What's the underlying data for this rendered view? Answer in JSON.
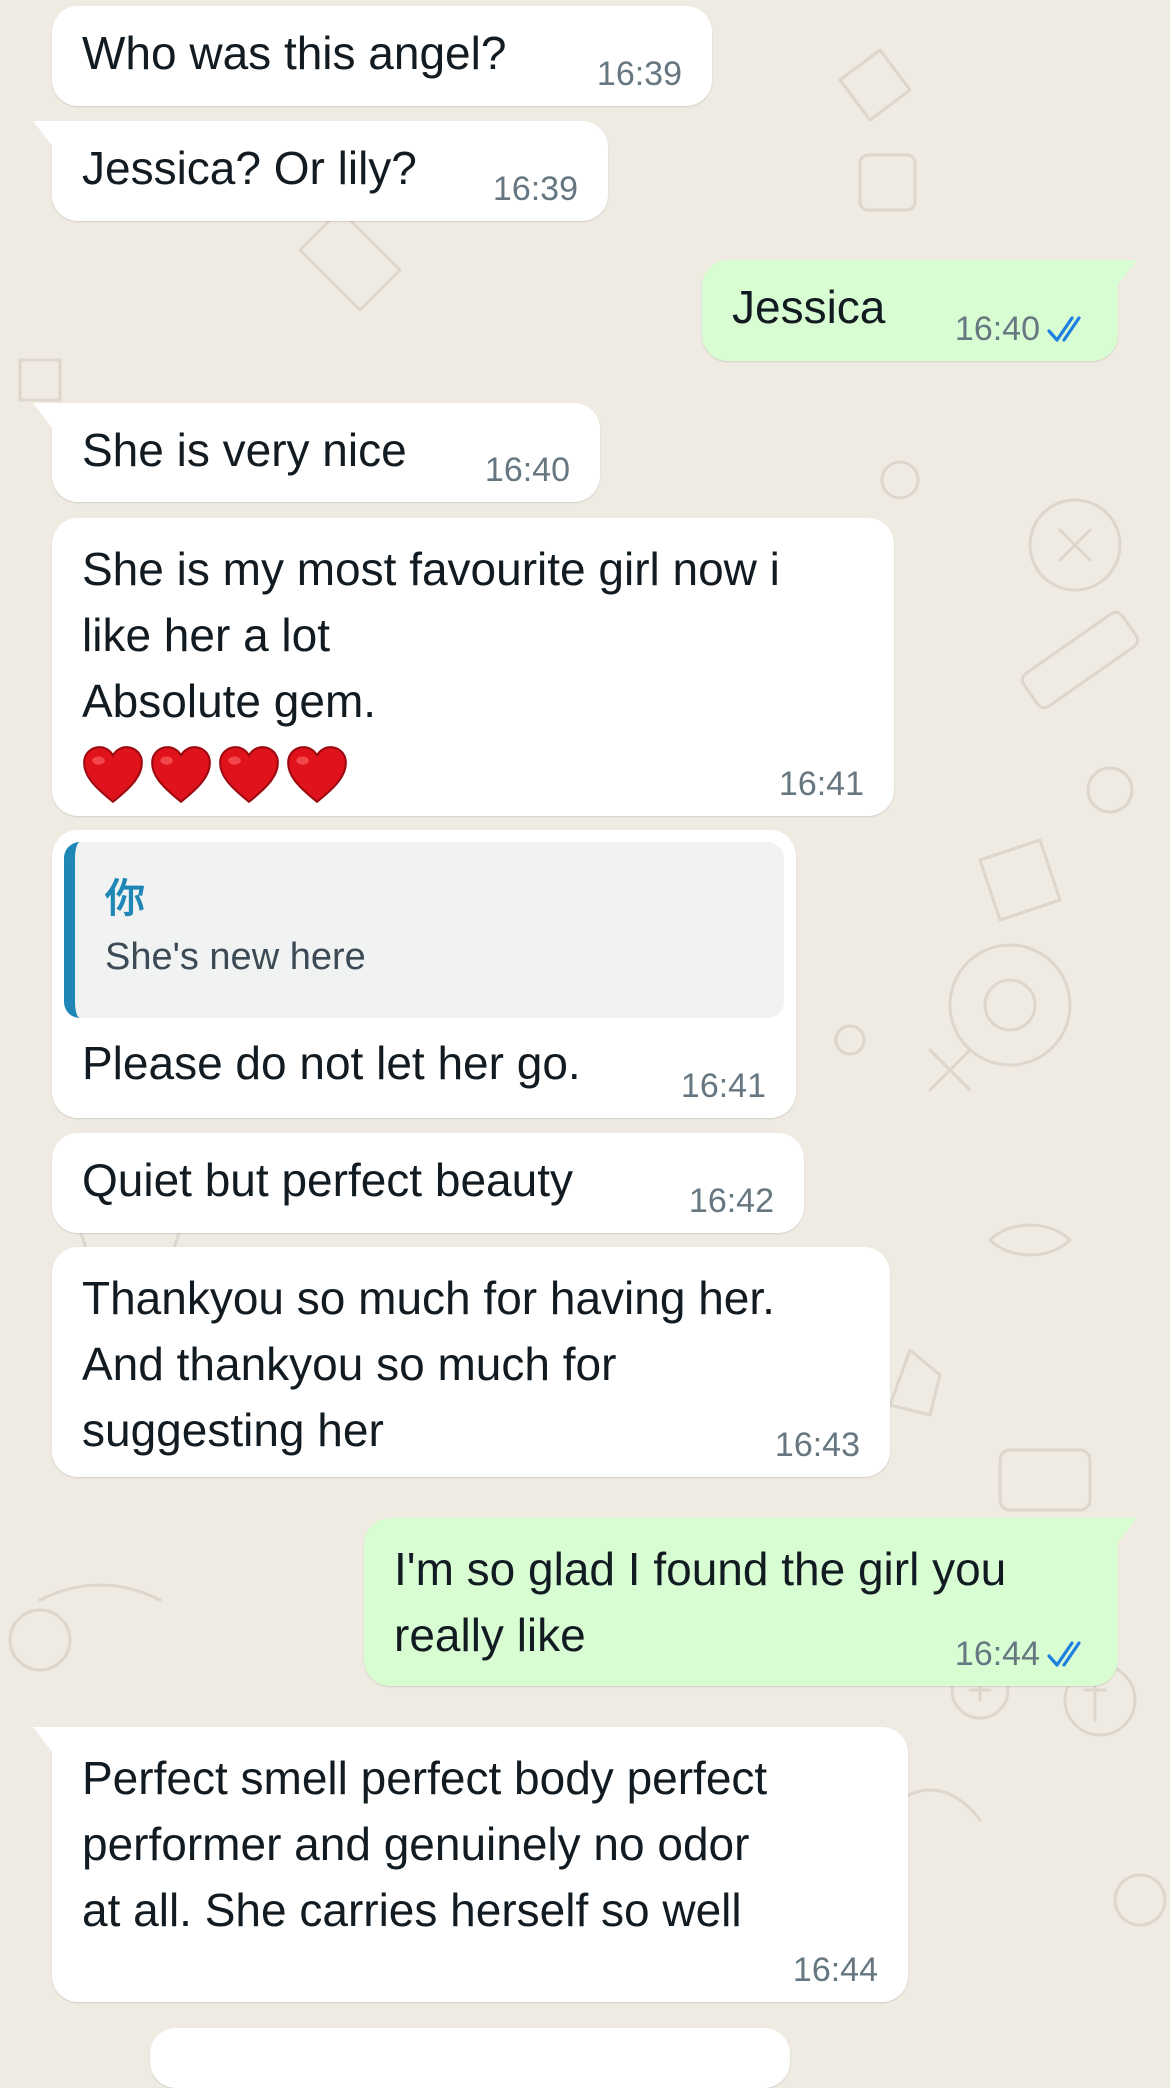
{
  "colors": {
    "chat_background": "#efeae2",
    "incoming_bubble": "#ffffff",
    "outgoing_bubble": "#d9fdd3",
    "read_receipt": "#1d7fe0",
    "quote_accent": "#1f87b5"
  },
  "messages": [
    {
      "direction": "incoming",
      "text": "Who was this angel?",
      "time": "16:39"
    },
    {
      "direction": "incoming",
      "text": "Jessica? Or lily?",
      "time": "16:39"
    },
    {
      "direction": "outgoing",
      "text": "Jessica",
      "time": "16:40",
      "status": "read",
      "status_icon": "double-check-icon"
    },
    {
      "direction": "incoming",
      "text": "She is very nice",
      "time": "16:40"
    },
    {
      "direction": "incoming",
      "text": "She is my most favourite girl now i\nlike her a lot\nAbsolute gem.",
      "emoji": "❤️❤️❤️❤️",
      "emoji_icon": "red-heart-icon",
      "time": "16:41"
    },
    {
      "direction": "incoming",
      "quoted": {
        "name": "你",
        "text": "She's new here"
      },
      "text": "Please do not let her go.",
      "time": "16:41"
    },
    {
      "direction": "incoming",
      "text": "Quiet but perfect beauty",
      "time": "16:42"
    },
    {
      "direction": "incoming",
      "text": "Thankyou so much for having her.\nAnd thankyou so much for\nsuggesting her",
      "time": "16:43"
    },
    {
      "direction": "outgoing",
      "text": "I'm so glad I found the girl you\nreally like",
      "time": "16:44",
      "status": "read",
      "status_icon": "double-check-icon"
    },
    {
      "direction": "incoming",
      "text": "Perfect smell perfect body perfect\nperformer and genuinely no odor\nat all. She carries herself so well",
      "time": "16:44"
    }
  ]
}
